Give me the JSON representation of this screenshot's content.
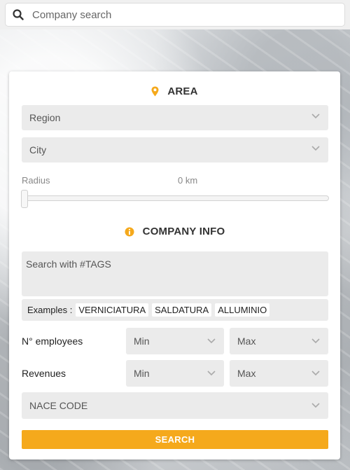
{
  "search": {
    "placeholder": "Company search"
  },
  "area": {
    "title": "AREA",
    "region_placeholder": "Region",
    "city_placeholder": "City",
    "radius_label": "Radius",
    "radius_value": "0 km",
    "radius_fraction": 0
  },
  "company_info": {
    "title": "COMPANY INFO",
    "tags_placeholder": "Search with #TAGS",
    "examples_label": "Examples :",
    "examples": [
      "VERNICIATURA",
      "SALDATURA",
      "ALLUMINIO"
    ],
    "employees_label": "N° employees",
    "revenues_label": "Revenues",
    "min_label": "Min",
    "max_label": "Max",
    "nace_placeholder": "NACE CODE"
  },
  "search_button": "SEARCH",
  "colors": {
    "accent": "#f5a91c",
    "field_bg": "#ebebeb"
  },
  "icons": {
    "search": "magnifier-icon",
    "area": "map-marker-icon",
    "info": "info-circle-icon",
    "dropdown": "chevron-down-icon"
  }
}
